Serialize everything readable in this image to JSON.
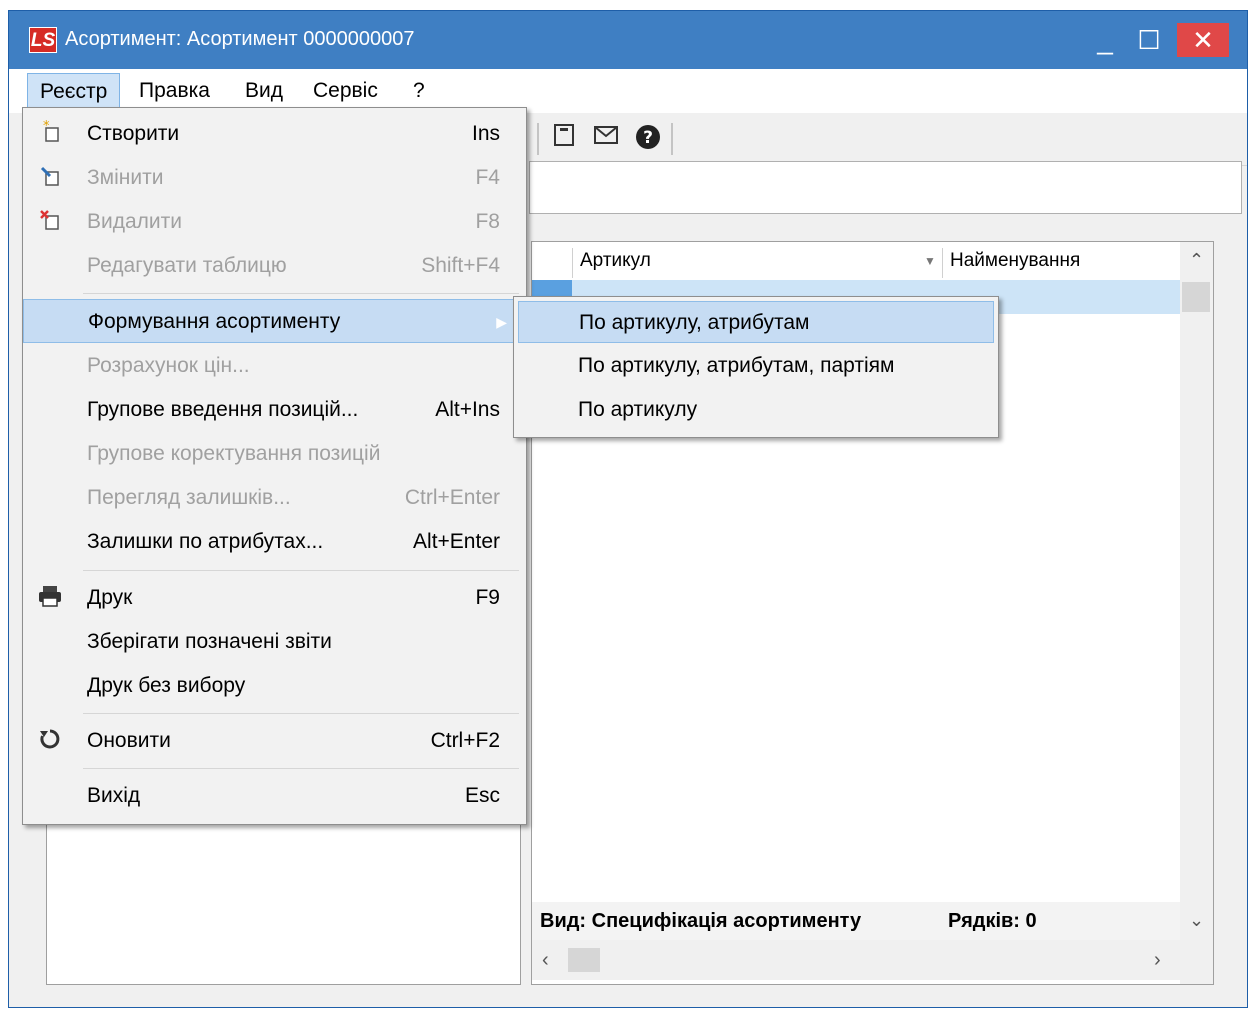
{
  "window": {
    "logo": "LS",
    "title": "Асортимент: Асортимент 0000000007",
    "controls": {
      "minimize": "_",
      "maximize": "☐",
      "close": "✕"
    }
  },
  "menubar": {
    "items": [
      {
        "label": "Реєстр"
      },
      {
        "label": "Правка"
      },
      {
        "label": "Вид"
      },
      {
        "label": "Сервіс"
      },
      {
        "label": "?"
      }
    ]
  },
  "toolbar": {
    "icons": [
      "document-icon",
      "mail-icon",
      "help-icon"
    ]
  },
  "grid": {
    "columns": [
      "Артикул",
      "Найменування"
    ],
    "status_view": "Вид: Специфікація асортименту",
    "status_rows": "Рядків: 0"
  },
  "menu": {
    "items": [
      {
        "label": "Створити",
        "shortcut": "Ins",
        "icon": "new-icon",
        "disabled": false
      },
      {
        "label": "Змінити",
        "shortcut": "F4",
        "icon": "edit-icon",
        "disabled": true
      },
      {
        "label": "Видалити",
        "shortcut": "F8",
        "icon": "delete-icon",
        "disabled": true
      },
      {
        "label": "Редагувати таблицю",
        "shortcut": "Shift+F4",
        "disabled": true
      },
      {
        "label": "Формування асортименту",
        "shortcut": "",
        "disabled": false,
        "submenu": true
      },
      {
        "label": "Розрахунок цін...",
        "shortcut": "",
        "disabled": true
      },
      {
        "label": "Групове введення позицій...",
        "shortcut": "Alt+Ins",
        "disabled": false
      },
      {
        "label": "Групове коректування позицій",
        "shortcut": "",
        "disabled": true
      },
      {
        "label": "Перегляд залишків...",
        "shortcut": "Ctrl+Enter",
        "disabled": true
      },
      {
        "label": "Залишки по атрибутах...",
        "shortcut": "Alt+Enter",
        "disabled": false
      },
      {
        "label": "Друк",
        "shortcut": "F9",
        "icon": "printer-icon",
        "disabled": false
      },
      {
        "label": "Зберігати позначені звіти",
        "shortcut": "",
        "disabled": false
      },
      {
        "label": "Друк без вибору",
        "shortcut": "",
        "disabled": false
      },
      {
        "label": "Оновити",
        "shortcut": "Ctrl+F2",
        "icon": "refresh-icon",
        "disabled": false
      },
      {
        "label": "Вихід",
        "shortcut": "Esc",
        "disabled": false
      }
    ]
  },
  "submenu": {
    "items": [
      {
        "label": "По артикулу, атрибутам"
      },
      {
        "label": "По артикулу, атрибутам, партіям"
      },
      {
        "label": "По артикулу"
      }
    ]
  },
  "colors": {
    "titlebar": "#3f7fc3",
    "close": "#e04848",
    "highlight": "#c6dcf3",
    "selection": "#5aa0e0"
  }
}
